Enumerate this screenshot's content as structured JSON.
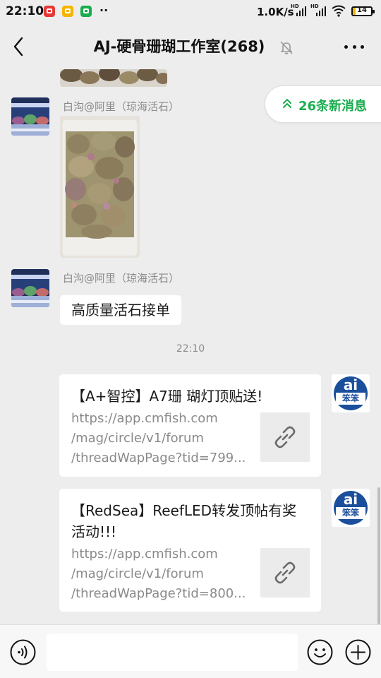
{
  "status_bar": {
    "time": "22:10",
    "more": "··",
    "speed": "1.0K/s",
    "hd_label": "HD",
    "battery_level": "14",
    "battery_fraction": 0.14
  },
  "header": {
    "title": "AJ-硬骨珊瑚工作室(268)",
    "muted": true
  },
  "new_messages": {
    "label": "26条新消息"
  },
  "messages": [
    {
      "type": "image",
      "content": "coral rubble rocks (partial)"
    },
    {
      "type": "image",
      "sender": "白沟@阿里（琼海活石）",
      "content": "live rocks in a box"
    },
    {
      "type": "text",
      "sender": "白沟@阿里（琼海活石）",
      "text": "高质量活石接单"
    },
    {
      "type": "time",
      "text": "22:10"
    },
    {
      "type": "link",
      "title": "【A+智控】A7珊 瑚灯顶贴送!",
      "url_lines": [
        "https://app.cmfish.com",
        "/mag/circle/v1/forum",
        "/threadWapPage?tid=799..."
      ]
    },
    {
      "type": "link",
      "title": "【RedSea】ReefLED转发顶帖有奖活动!!!",
      "url_lines": [
        "https://app.cmfish.com",
        "/mag/circle/v1/forum",
        "/threadWapPage?tid=800..."
      ]
    }
  ],
  "bot_avatar": {
    "top_text": "ai",
    "bottom_text": "笨笨"
  },
  "colors": {
    "background": "#ededed",
    "accent_green": "#1aad4e",
    "bubble": "#ffffff",
    "meta_gray": "#8a8a8a",
    "bot_blue": "#1b4f9c"
  },
  "input": {
    "value": ""
  }
}
